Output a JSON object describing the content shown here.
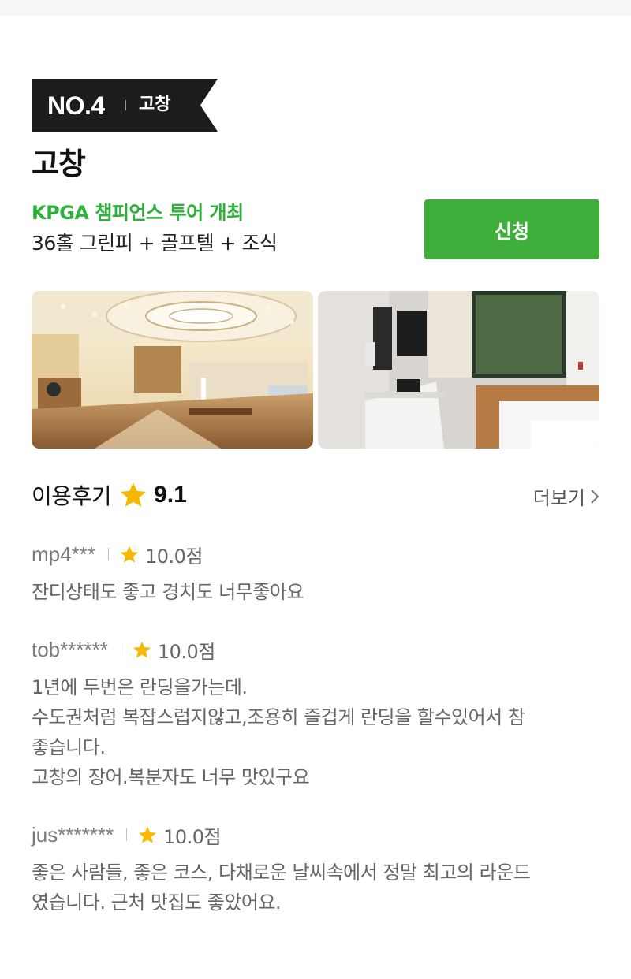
{
  "rank": {
    "number": "NO.4",
    "region": "고창"
  },
  "course": {
    "title": "고창",
    "highlight": "KPGA 챔피언스 투어 개최",
    "package": "36홀 그린피 + 골프텔 + 조식"
  },
  "apply_label": "신청",
  "photos": [
    "clubhouse-lobby-photo",
    "golftel-room-photo"
  ],
  "reviews_section": {
    "label": "이용후기",
    "score": "9.1",
    "more_label": "더보기"
  },
  "reviews": [
    {
      "author": "mp4***",
      "rating": "10.0점",
      "text": "잔디상태도 좋고 경치도 너무좋아요"
    },
    {
      "author": "tob******",
      "rating": "10.0점",
      "text": "1년에 두번은 란딩을가는데.\n수도권처럼 복잡스럽지않고,조용히 즐겁게 란딩을 할수있어서 참\n좋습니다.\n고창의 장어.복분자도 너무 맛있구요"
    },
    {
      "author": "jus*******",
      "rating": "10.0점",
      "text": "좋은 사람들, 좋은 코스, 다채로운 날씨속에서 정말 최고의 라운드\n였습니다. 근처 맛집도 좋았어요."
    }
  ],
  "colors": {
    "accent_green": "#3eaf3a",
    "highlight_green": "#2db13a",
    "star": "#f6b800",
    "tag_bg": "#1c1c1c"
  },
  "icons": {
    "star": "star-icon",
    "chevron": "chevron-right-icon"
  }
}
